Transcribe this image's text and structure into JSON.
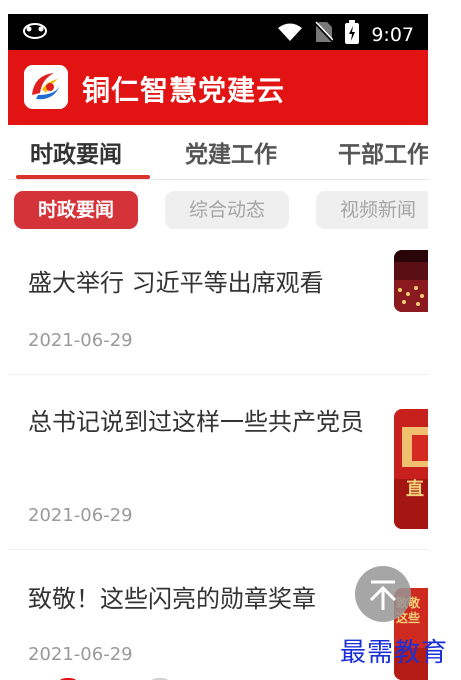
{
  "status_bar": {
    "time": "9:07",
    "left_icon": "notification-icon",
    "icons": [
      "wifi-icon",
      "no-sim-icon",
      "battery-charging-icon"
    ]
  },
  "app_bar": {
    "title": "铜仁智慧党建云",
    "logo": "party-logo-icon",
    "color": "#e21313"
  },
  "tabs": [
    {
      "label": "时政要闻",
      "active": true
    },
    {
      "label": "党建工作",
      "active": false
    },
    {
      "label": "干部工作",
      "active": false
    }
  ],
  "sub_tabs": [
    {
      "label": "时政要闻",
      "active": true
    },
    {
      "label": "综合动态",
      "active": false
    },
    {
      "label": "视频新闻",
      "active": false
    }
  ],
  "news": [
    {
      "title": "盛大举行 习近平等出席观看",
      "date": "2021-06-29"
    },
    {
      "title": "总书记说到过这样一些共产党员",
      "date": "2021-06-29"
    },
    {
      "title": "致敬！这些闪亮的勋章奖章",
      "date": "2021-06-29"
    }
  ],
  "thumbnails": {
    "thumb2_text": "直",
    "thumb3_text": "致敬这些"
  },
  "back_to_top": "arrow-up-icon",
  "watermark": "最需教育",
  "colors": {
    "accent": "#d9312b",
    "chip_active": "#d4333a",
    "watermark": "#1a2fd8"
  }
}
